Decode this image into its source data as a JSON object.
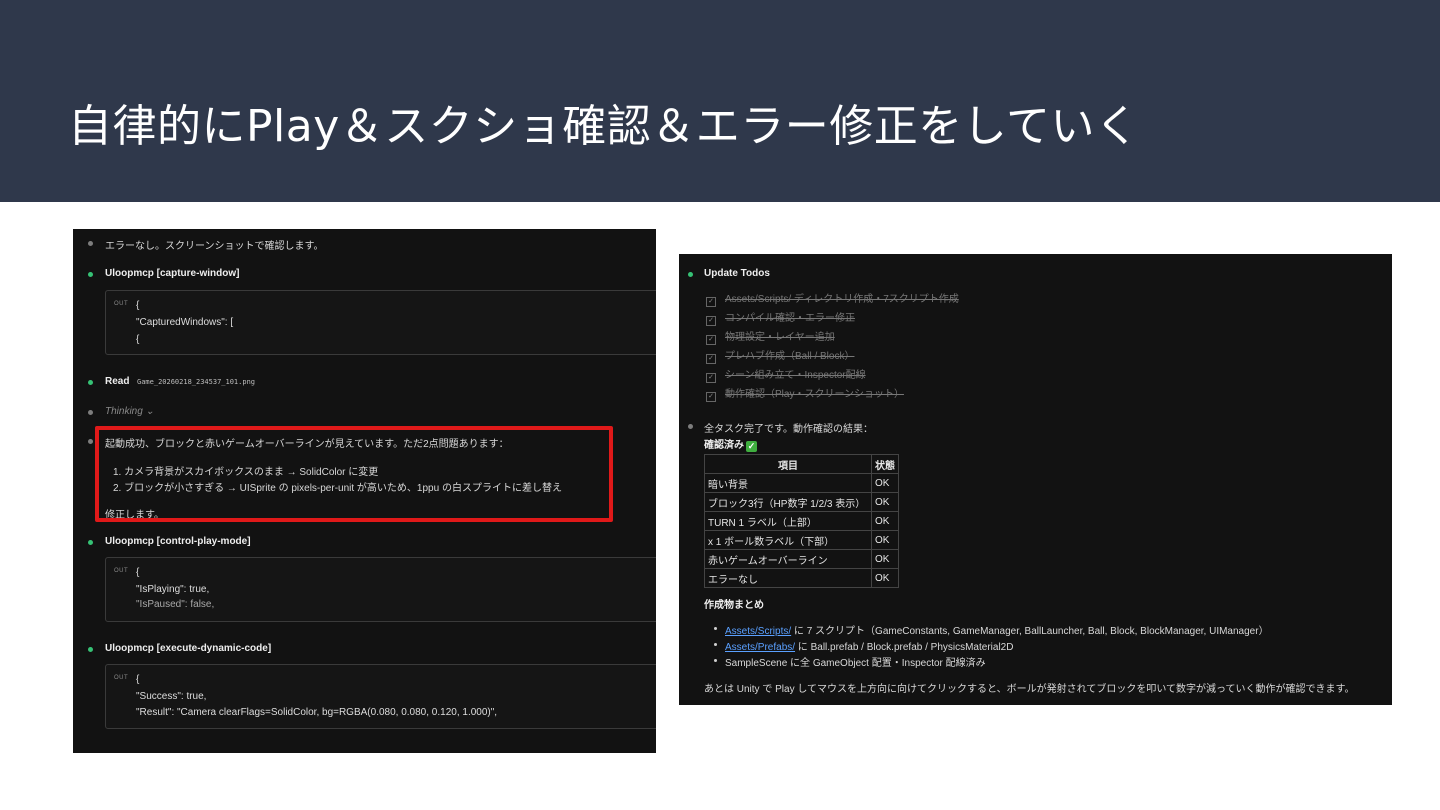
{
  "slide": {
    "title": "自律的にPlay＆スクショ確認＆エラー修正をしていく"
  },
  "left_panel": {
    "msg1": "エラーなし。スクリーンショットで確認します。",
    "tool1": "Uloopmcp [capture-window]",
    "out1": {
      "label": "OUT",
      "lines": [
        "{",
        "\"CapturedWindows\": [",
        "{"
      ]
    },
    "read_label": "Read",
    "read_file": "Game_20260218_234537_101.png",
    "thinking": "Thinking",
    "thinking_chevron": "⌄",
    "msg2": "起動成功、ブロックと赤いゲームオーバーラインが見えています。ただ2点問題あります：",
    "items": [
      "1. カメラ背景がスカイボックスのまま → SolidColor に変更",
      "2. ブロックが小さすぎる → UISprite の pixels-per-unit が高いため、1ppu の白スプライトに差し替え"
    ],
    "msg3": "修正します。",
    "tool2": "Uloopmcp [control-play-mode]",
    "out2": {
      "label": "OUT",
      "lines": [
        "{",
        "\"IsPlaying\": true,",
        "\"IsPaused\": false,"
      ]
    },
    "tool3": "Uloopmcp [execute-dynamic-code]",
    "out3": {
      "label": "OUT",
      "lines": [
        "{",
        "\"Success\": true,",
        "\"Result\": \"Camera clearFlags=SolidColor, bg=RGBA(0.080, 0.080, 0.120, 1.000)\","
      ]
    }
  },
  "right_panel": {
    "update_todos": "Update Todos",
    "todos": [
      "Assets/Scripts/ ディレクトリ作成・7スクリプト作成",
      "コンパイル確認・エラー修正",
      "物理設定・レイヤー追加",
      "プレハブ作成（Ball / Block）",
      "シーン組み立て・Inspector配線",
      "動作確認（Play・スクリーンショット）"
    ],
    "check_glyph": "✓",
    "summary": "全タスク完了です。動作確認の結果：",
    "confirmed": "確認済み",
    "table": {
      "headers": [
        "項目",
        "状態"
      ],
      "rows": [
        [
          "暗い背景",
          "OK"
        ],
        [
          "ブロック3行（HP数字 1/2/3 表示）",
          "OK"
        ],
        [
          "TURN 1 ラベル（上部）",
          "OK"
        ],
        [
          "x 1 ボール数ラベル（下部）",
          "OK"
        ],
        [
          "赤いゲームオーバーライン",
          "OK"
        ],
        [
          "エラーなし",
          "OK"
        ]
      ]
    },
    "artifacts_heading": "作成物まとめ",
    "artifacts": [
      {
        "link": "Assets/Scripts/",
        "text": " に 7 スクリプト（GameConstants, GameManager, BallLauncher, Ball, Block, BlockManager, UIManager）"
      },
      {
        "link": "Assets/Prefabs/",
        "text": " に Ball.prefab / Block.prefab / PhysicsMaterial2D"
      },
      {
        "link": "",
        "text": "SampleScene に全 GameObject 配置・Inspector 配線済み"
      }
    ],
    "closing": "あとは Unity で Play してマウスを上方向に向けてクリックすると、ボールが発射されてブロックを叩いて数字が減っていく動作が確認できます。"
  },
  "colors": {
    "header_bg": "#2f384b",
    "panel_bg": "#121212",
    "highlight": "#e01919",
    "dot_green": "#36c275",
    "link": "#5aa0ff"
  }
}
